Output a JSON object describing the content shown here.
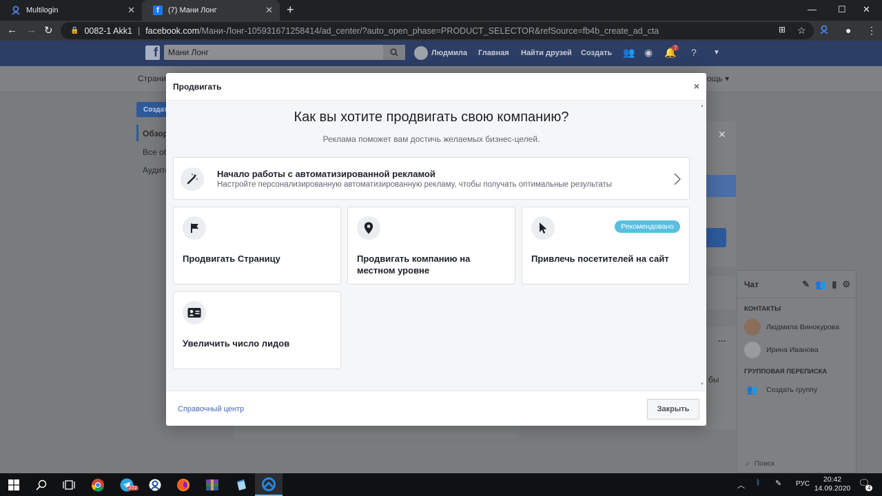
{
  "browser": {
    "tabs": [
      {
        "title": "Multilogin",
        "icon": "multilogin-icon"
      },
      {
        "title": "(7) Мани Лонг",
        "icon": "facebook-icon"
      }
    ],
    "new_tab_glyph": "+",
    "profile_label": "0082-1 Akk1",
    "url_host": "facebook.com",
    "url_path": "/Мани-Лонг-105931671258414/ad_center/?auto_open_phase=PRODUCT_SELECTOR&refSource=fb4b_create_ad_cta"
  },
  "facebook": {
    "logo_letter": "f",
    "search_value": "Мани Лонг",
    "user_name": "Людмила",
    "nav": {
      "home": "Главная",
      "find_friends": "Найти друзей",
      "create": "Создать"
    },
    "notification_count": "7",
    "sub_left": "Страни",
    "sub_right": "ощь ▾",
    "create_button": "Создат",
    "left_menu": [
      "Обзор",
      "Все об",
      "Аудито"
    ],
    "bg_fragment": "бы"
  },
  "chat": {
    "title": "Чат",
    "contacts_header": "КОНТАКТЫ",
    "contacts": [
      "Людмила Винокурова",
      "Ирина Иванова"
    ],
    "group_header": "ГРУППОВАЯ ПЕРЕПИСКА",
    "create_group": "Создать группу",
    "search_placeholder": "Поиск"
  },
  "modal": {
    "header": "Продвигать",
    "close_glyph": "×",
    "title": "Как вы хотите продвигать свою компанию?",
    "subtitle": "Реклама поможет вам достичь желаемых бизнес-целей.",
    "auto_ads": {
      "title": "Начало работы с автоматизированной рекламой",
      "description": "Настройте персонализированную автоматизированную рекламу, чтобы получать оптимальные результаты"
    },
    "options": [
      {
        "label": "Продвигать Страницу",
        "icon": "flag-icon"
      },
      {
        "label": "Продвигать компанию на местном уровне",
        "icon": "location-pin-icon"
      },
      {
        "label": "Привлечь посетителей на сайт",
        "icon": "cursor-icon",
        "badge": "Рекомендовано"
      },
      {
        "label": "Увеличить число лидов",
        "icon": "contact-card-icon"
      }
    ],
    "help_link": "Справочный центр",
    "close_button": "Закрыть"
  },
  "taskbar": {
    "apps": [
      "windows-start-icon",
      "search-icon",
      "task-view-icon",
      "chrome-icon",
      "telegram-icon",
      "multilogin-icon",
      "firefox-icon",
      "winrar-icon",
      "notepad-icon",
      "app-icon"
    ],
    "telegram_badge": "272",
    "language": "РУС",
    "time": "20:42",
    "date": "14.09.2020",
    "notifications_count": "4"
  },
  "colors": {
    "fb_blue": "#4267b2",
    "badge_cyan": "#57bfe1",
    "chrome_dark": "#202124"
  }
}
